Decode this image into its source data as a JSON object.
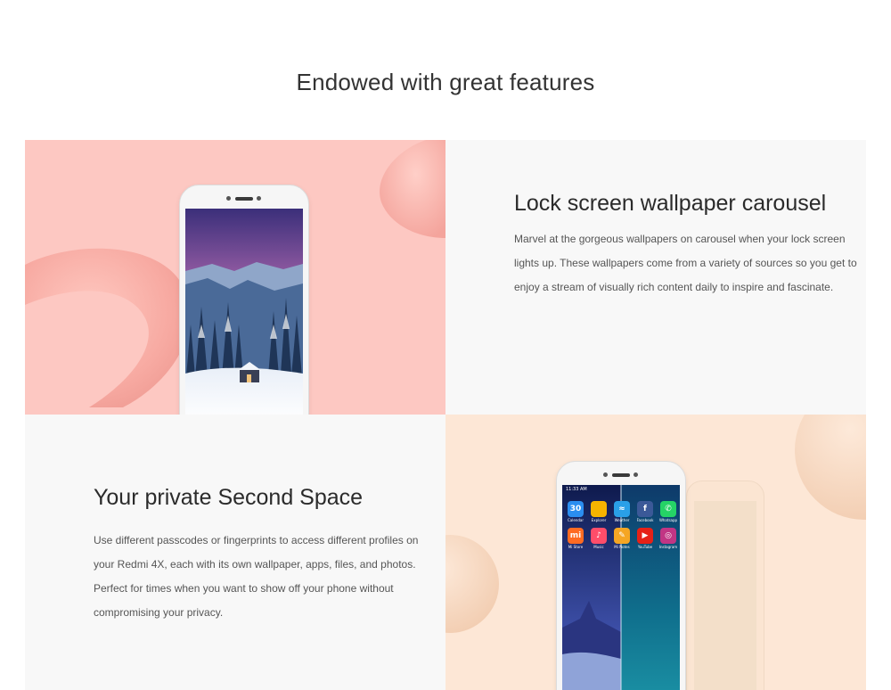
{
  "page": {
    "title": "Endowed with great features"
  },
  "features": [
    {
      "title": "Lock screen wallpaper carousel",
      "description": "Marvel at the gorgeous wallpapers on carousel when your lock screen lights up. These wallpapers come from a variety of sources so you get to enjoy a stream of visually rich content daily to inspire and fascinate."
    },
    {
      "title": "Your private Second Space",
      "description": "Use different passcodes or fingerprints to access different profiles on your Redmi 4X, each with its own wallpaper, apps, files, and photos. Perfect for times when you want to show off your phone without compromising your privacy."
    }
  ],
  "second_space_phone": {
    "status_time": "11:33 AM",
    "date_icon_value": "30",
    "apps": [
      {
        "label": "Calendar",
        "icon": "calendar-icon",
        "color": "#2b8ef0"
      },
      {
        "label": "Explorer",
        "icon": "explorer-icon",
        "color": "#f6b400"
      },
      {
        "label": "Weather",
        "icon": "weather-icon",
        "color": "#2aa0e8"
      },
      {
        "label": "Facebook",
        "icon": "facebook-icon",
        "color": "#3b5998"
      },
      {
        "label": "Whatsapp",
        "icon": "whatsapp-icon",
        "color": "#25d366"
      },
      {
        "label": "Mi Store",
        "icon": "mi-store-icon",
        "color": "#ff6b22"
      },
      {
        "label": "Music",
        "icon": "music-icon",
        "color": "#ff4d6a"
      },
      {
        "label": "Mi Notes",
        "icon": "mi-notes-icon",
        "color": "#f5a623"
      },
      {
        "label": "YouTube",
        "icon": "youtube-icon",
        "color": "#e62117"
      },
      {
        "label": "Instagram",
        "icon": "instagram-icon",
        "color": "#c13584"
      }
    ]
  },
  "colors": {
    "pink_panel": "#fdc8c2",
    "peach_panel": "#fde7d6",
    "light_panel": "#f8f8f8"
  }
}
